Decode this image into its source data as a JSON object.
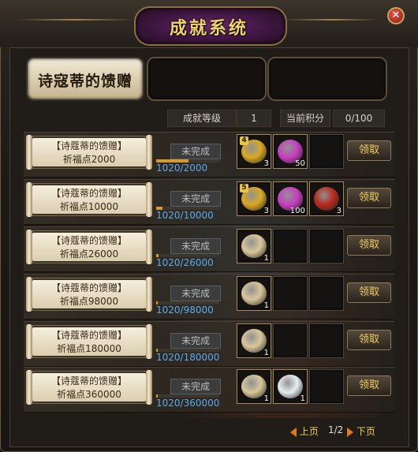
{
  "window": {
    "title": "成就系统",
    "close_icon": "close-icon"
  },
  "tabs": [
    {
      "label": "诗寇蒂的馈赠",
      "active": true
    },
    {
      "label": "",
      "active": false
    },
    {
      "label": "",
      "active": false
    }
  ],
  "stats": {
    "level_label": "成就等级",
    "level_value": "1",
    "points_label": "当前积分",
    "points_value": "0/100"
  },
  "rows": [
    {
      "title": "【诗蔻蒂的馈赠】",
      "subtitle": "祈福点2000",
      "status": "未完成",
      "progress": "1020/2000",
      "progress_ratio": 0.51,
      "claim": "领取",
      "items": [
        {
          "icon": "gold-coin-icon",
          "color": "#d9a824",
          "tier": "4",
          "count": "3"
        },
        {
          "icon": "pink-gem-icon",
          "color": "#c83fc0",
          "count": "50"
        }
      ]
    },
    {
      "title": "【诗蔻蒂的馈赠】",
      "subtitle": "祈福点10000",
      "status": "未完成",
      "progress": "1020/10000",
      "progress_ratio": 0.102,
      "claim": "领取",
      "items": [
        {
          "icon": "gold-coin-icon",
          "color": "#d9a824",
          "tier": "5",
          "count": "3"
        },
        {
          "icon": "pink-gem-icon",
          "color": "#c83fc0",
          "count": "100"
        },
        {
          "icon": "red-scroll-icon",
          "color": "#b62a1e",
          "count": "3"
        }
      ]
    },
    {
      "title": "【诗蔻蒂的馈赠】",
      "subtitle": "祈福点26000",
      "status": "未完成",
      "progress": "1020/26000",
      "progress_ratio": 0.039,
      "claim": "领取",
      "items": [
        {
          "icon": "fortune-scroll-icon",
          "color": "#d8c79a",
          "count": "1"
        }
      ]
    },
    {
      "title": "【诗蔻蒂的馈赠】",
      "subtitle": "祈福点98000",
      "status": "未完成",
      "progress": "1020/98000",
      "progress_ratio": 0.01,
      "claim": "领取",
      "items": [
        {
          "icon": "fortune-scroll-icon",
          "color": "#d8c79a",
          "count": "1"
        }
      ]
    },
    {
      "title": "【诗蔻蒂的馈赠】",
      "subtitle": "祈福点180000",
      "status": "未完成",
      "progress": "1020/180000",
      "progress_ratio": 0.006,
      "claim": "领取",
      "items": [
        {
          "icon": "fortune-scroll-icon",
          "color": "#d8c79a",
          "count": "1"
        }
      ]
    },
    {
      "title": "【诗蔻蒂的馈赠】",
      "subtitle": "祈福点360000",
      "status": "未完成",
      "progress": "1020/360000",
      "progress_ratio": 0.003,
      "claim": "领取",
      "items": [
        {
          "icon": "fortune-scroll-icon",
          "color": "#d8c79a",
          "count": "1"
        },
        {
          "icon": "white-orb-icon",
          "color": "#e8ecf0",
          "count": "1"
        }
      ]
    }
  ],
  "pager": {
    "prev": "上页",
    "page": "1/2",
    "next": "下页"
  }
}
